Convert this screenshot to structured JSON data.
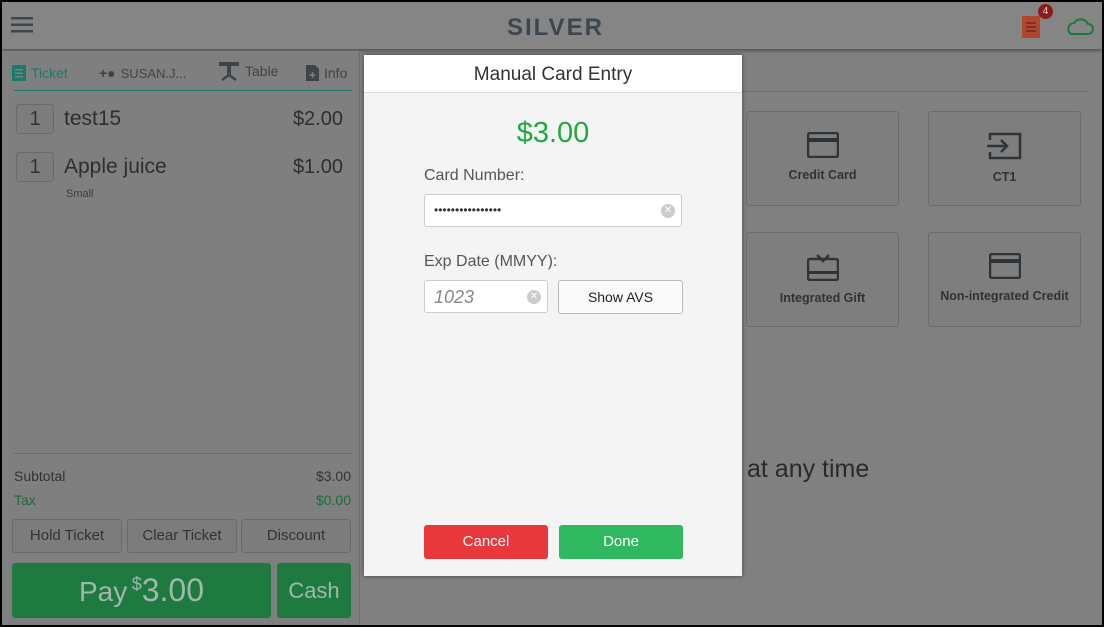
{
  "header": {
    "brand": "SILVER",
    "notification_count": "4"
  },
  "ticket_tabs": [
    {
      "label": "Ticket"
    },
    {
      "label": "SUSAN.J..."
    },
    {
      "label": "Table"
    },
    {
      "label": "Info"
    }
  ],
  "items": [
    {
      "qty": "1",
      "name": "test15",
      "price": "$2.00",
      "modifier": ""
    },
    {
      "qty": "1",
      "name": "Apple juice",
      "price": "$1.00",
      "modifier": "Small"
    }
  ],
  "totals": {
    "subtotal_label": "Subtotal",
    "subtotal": "$3.00",
    "tax_label": "Tax",
    "tax": "$0.00"
  },
  "actions": {
    "hold": "Hold Ticket",
    "clear": "Clear Ticket",
    "discount": "Discount",
    "pay_label": "Pay",
    "pay_currency": "$",
    "pay_amount": "3.00",
    "cash": "Cash"
  },
  "payment_tiles": [
    {
      "label": "Credit Card",
      "icon": "credit-card-icon"
    },
    {
      "label": "CT1",
      "icon": "input-arrow-icon"
    },
    {
      "label": "Integrated Gift",
      "icon": "gift-card-icon"
    },
    {
      "label": "Non-integrated Credit",
      "icon": "credit-card-icon"
    }
  ],
  "background_text": "at any time",
  "modal": {
    "title": "Manual Card Entry",
    "amount": "$3.00",
    "card_label": "Card Number:",
    "card_value": "••••••••••••••••",
    "exp_label": "Exp Date (MMYY):",
    "exp_placeholder": "1023",
    "show_avs": "Show AVS",
    "cancel": "Cancel",
    "done": "Done"
  },
  "colors": {
    "accent_green": "#2fb85f",
    "cancel_red": "#e8383d",
    "amount_green": "#1faa3c",
    "badge_red": "#b71c1c"
  }
}
